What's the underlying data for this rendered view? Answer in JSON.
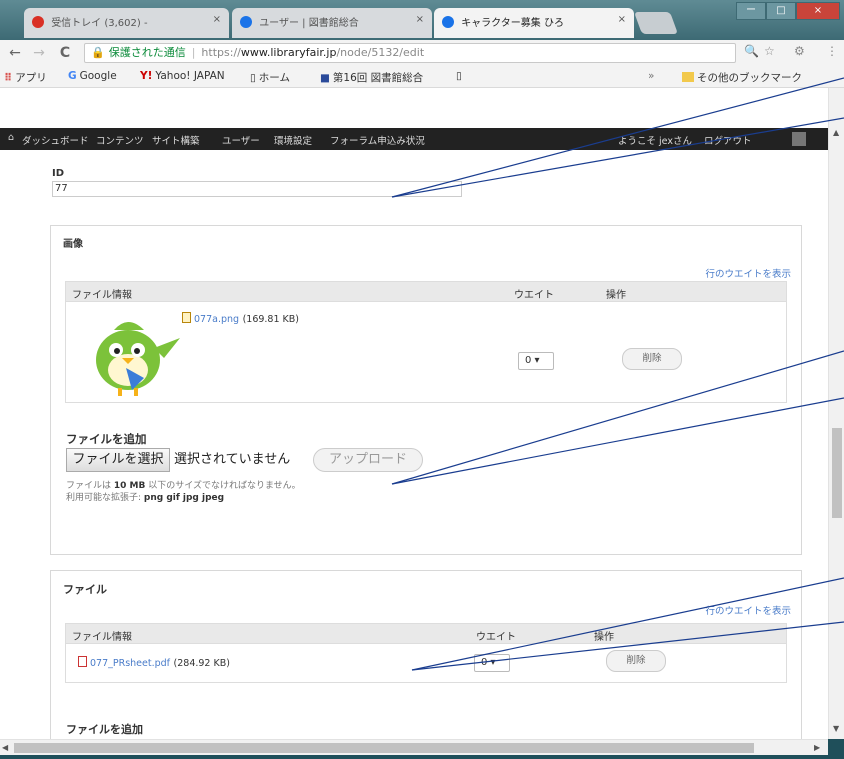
{
  "browser": {
    "tabs": [
      {
        "label": "受信トレイ (3,602) - ",
        "favicon_color": "#d93025"
      },
      {
        "label": "ユーザー | 図書館総合",
        "favicon_color": "#1a73e8"
      },
      {
        "label": "キャラクター募集 ひろ",
        "favicon_color": "#1a73e8"
      }
    ],
    "tab_close": "×",
    "window_buttons": [
      "ー",
      "□",
      "×"
    ],
    "nav": {
      "back": "←",
      "forward": "→",
      "reload": "C"
    },
    "address": {
      "lock": "🔒",
      "secure_label": "保護された通信",
      "scheme": "https://",
      "host": "www.libraryfair.jp",
      "path": "/node/5132/edit"
    },
    "toolbar_icons": {
      "zoom": "🔍",
      "star": "☆",
      "ext": "⚙",
      "menu": "⋮"
    },
    "bookmarks": [
      {
        "icon": "⠿",
        "label": "アプリ"
      },
      {
        "icon": "G",
        "label": "Google"
      },
      {
        "icon": "Y!",
        "label": "Yahoo! JAPAN"
      },
      {
        "icon": "▯",
        "label": "ホーム"
      },
      {
        "icon": "■",
        "label": "第16回 図書館総合"
      },
      {
        "icon": "▯",
        "label": ""
      }
    ],
    "bookmarks_more": "»",
    "other_bookmarks": "その他のブックマーク"
  },
  "admin_bar": {
    "home_icon": "⌂",
    "items": [
      "ダッシュボード",
      "コンテンツ",
      "サイト構築",
      "ユーザー",
      "環境設定",
      "フォーラム申込み状況"
    ],
    "welcome": "ようこそ jexさん",
    "logout": "ログアウト"
  },
  "id_field": {
    "label": "ID",
    "value": "77"
  },
  "image_section": {
    "title": "画像",
    "weight_link": "行のウエイトを表示",
    "columns": [
      "ファイル情報",
      "ウエイト",
      "操作"
    ],
    "file": {
      "name": "077a.png",
      "size": "(169.81 KB)"
    },
    "weight": "0 ▾",
    "delete": "削除",
    "add_label": "ファイルを追加",
    "choose_button": "ファイルを選択",
    "no_file": "選択されていません",
    "upload_button": "アップロード",
    "help_prefix": "ファイルは ",
    "help_size": "10 MB",
    "help_suffix": " 以下のサイズでなければなりません。",
    "help_ext_prefix": "利用可能な拡張子: ",
    "help_ext": "png gif jpg jpeg"
  },
  "file_section": {
    "title": "ファイル",
    "weight_link": "行のウエイトを表示",
    "columns": [
      "ファイル情報",
      "ウエイト",
      "操作"
    ],
    "file": {
      "name": "077_PRsheet.pdf",
      "size": "(284.92 KB)"
    },
    "weight": "0 ▾",
    "delete": "削除",
    "add_label": "ファイルを追加"
  },
  "scrollbar": {
    "up": "▲",
    "down": "▼",
    "left": "◀",
    "right": "▶"
  },
  "colors": {
    "link": "#4a7cc9",
    "annotation": "#1a3d8f",
    "admin_bar": "#222222"
  }
}
